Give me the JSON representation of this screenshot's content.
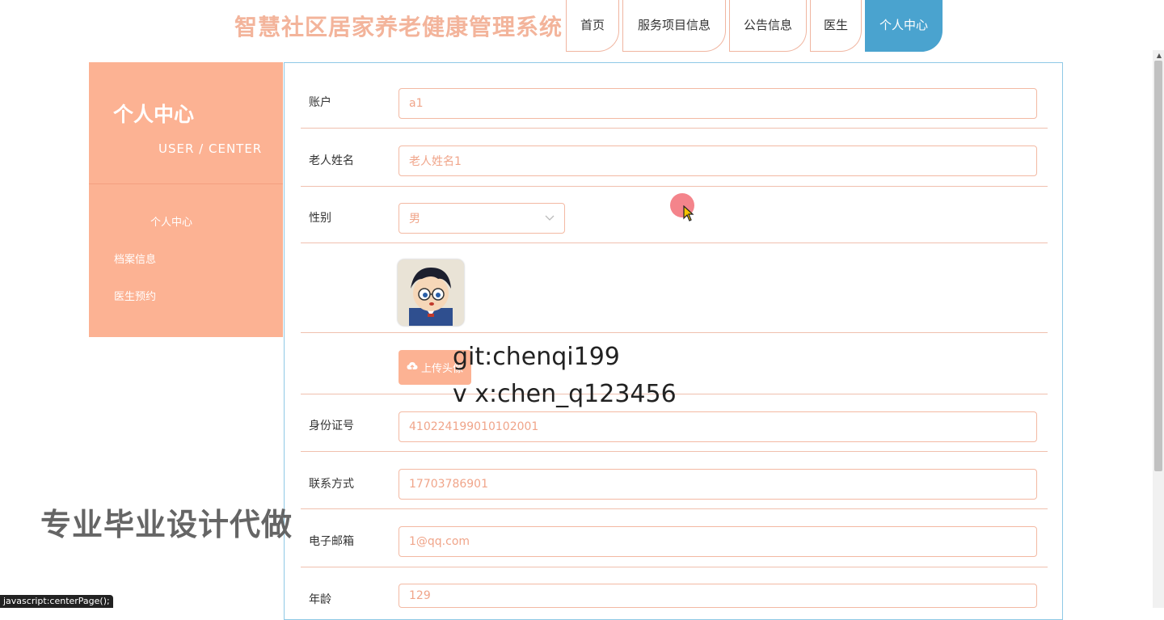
{
  "header": {
    "title": "智慧社区居家养老健康管理系统",
    "nav": [
      {
        "label": "首页",
        "active": false
      },
      {
        "label": "服务项目信息",
        "active": false
      },
      {
        "label": "公告信息",
        "active": false
      },
      {
        "label": "医生",
        "active": false
      },
      {
        "label": "个人中心",
        "active": true
      }
    ]
  },
  "sidebar": {
    "title": "个人中心",
    "subtitle": "USER / CENTER",
    "items": [
      {
        "label": "个人中心"
      },
      {
        "label": "档案信息"
      },
      {
        "label": "医生预约"
      }
    ]
  },
  "form": {
    "account": {
      "label": "账户",
      "value": "a1"
    },
    "name": {
      "label": "老人姓名",
      "value": "老人姓名1"
    },
    "gender": {
      "label": "性别",
      "value": "男"
    },
    "upload_label": "上传头像",
    "id_card": {
      "label": "身份证号",
      "value": "410224199010102001"
    },
    "phone": {
      "label": "联系方式",
      "value": "17703786901"
    },
    "email": {
      "label": "电子邮箱",
      "value": "1@qq.com"
    },
    "age": {
      "label": "年龄",
      "value": "129"
    }
  },
  "overlays": {
    "git": "git:chenqi199",
    "vx": "v x:chen_q123456",
    "watermark": "专业毕业设计代做",
    "status": "javascript:centerPage();"
  },
  "colors": {
    "accent": "#fcb293",
    "title": "#f3b49b",
    "active_tab": "#4aa3cf",
    "panel_border": "#8fc9e6"
  }
}
